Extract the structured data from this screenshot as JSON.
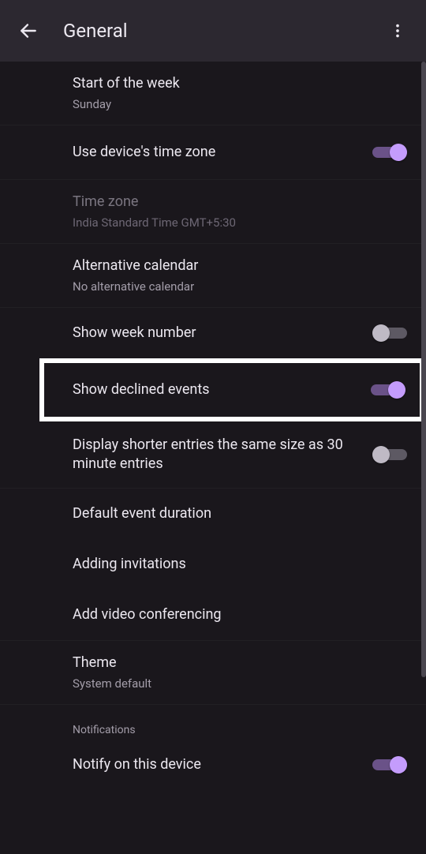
{
  "header": {
    "title": "General"
  },
  "items": {
    "startOfWeek": {
      "label": "Start of the week",
      "value": "Sunday"
    },
    "useDeviceTz": {
      "label": "Use device's time zone",
      "on": true
    },
    "timeZone": {
      "label": "Time zone",
      "value": "India Standard Time  GMT+5:30"
    },
    "altCalendar": {
      "label": "Alternative calendar",
      "value": "No alternative calendar"
    },
    "weekNumber": {
      "label": "Show week number",
      "on": false
    },
    "declined": {
      "label": "Show declined events",
      "on": true
    },
    "shorter": {
      "label": "Display shorter entries the same size as 30 minute entries",
      "on": false
    },
    "defaultDur": {
      "label": "Default event duration"
    },
    "invitations": {
      "label": "Adding invitations"
    },
    "videoConf": {
      "label": "Add video conferencing"
    },
    "theme": {
      "label": "Theme",
      "value": "System default"
    },
    "notifSection": {
      "label": "Notifications"
    },
    "notifyDevice": {
      "label": "Notify on this device",
      "on": true
    }
  }
}
